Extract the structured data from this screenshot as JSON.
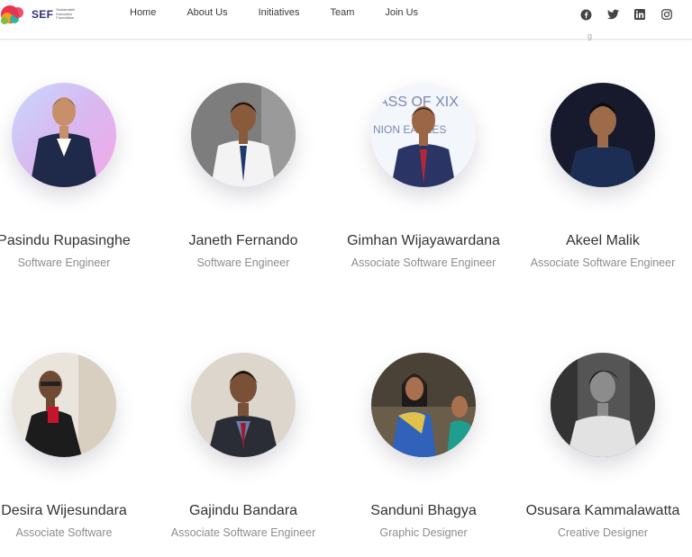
{
  "nav": {
    "logo_text": "SEF",
    "logo_sub": "Sustainable Education Foundation",
    "links": [
      "Home",
      "About Us",
      "Initiatives",
      "Team",
      "Join Us"
    ],
    "socials": [
      "facebook-icon",
      "twitter-icon",
      "linkedin-icon",
      "instagram-icon"
    ],
    "faint": "g"
  },
  "team": [
    {
      "name": "Pasindu Rupasinghe",
      "role": "Software Engineer"
    },
    {
      "name": "Janeth Fernando",
      "role": "Software Engineer"
    },
    {
      "name": "Gimhan Wijayawardana",
      "role": "Associate Software Engineer"
    },
    {
      "name": "Akeel Malik",
      "role": "Associate Software Engineer"
    },
    {
      "name": "Desira Wijesundara",
      "role": "Associate Software"
    },
    {
      "name": "Gajindu Bandara",
      "role": "Associate Software Engineer"
    },
    {
      "name": "Sanduni Bhagya",
      "role": "Graphic Designer"
    },
    {
      "name": "Osusara Kammalawatta",
      "role": "Creative Designer"
    }
  ],
  "colors": {
    "brand": "#2b2f7a",
    "name": "#333333",
    "role": "#8d8d8d"
  }
}
